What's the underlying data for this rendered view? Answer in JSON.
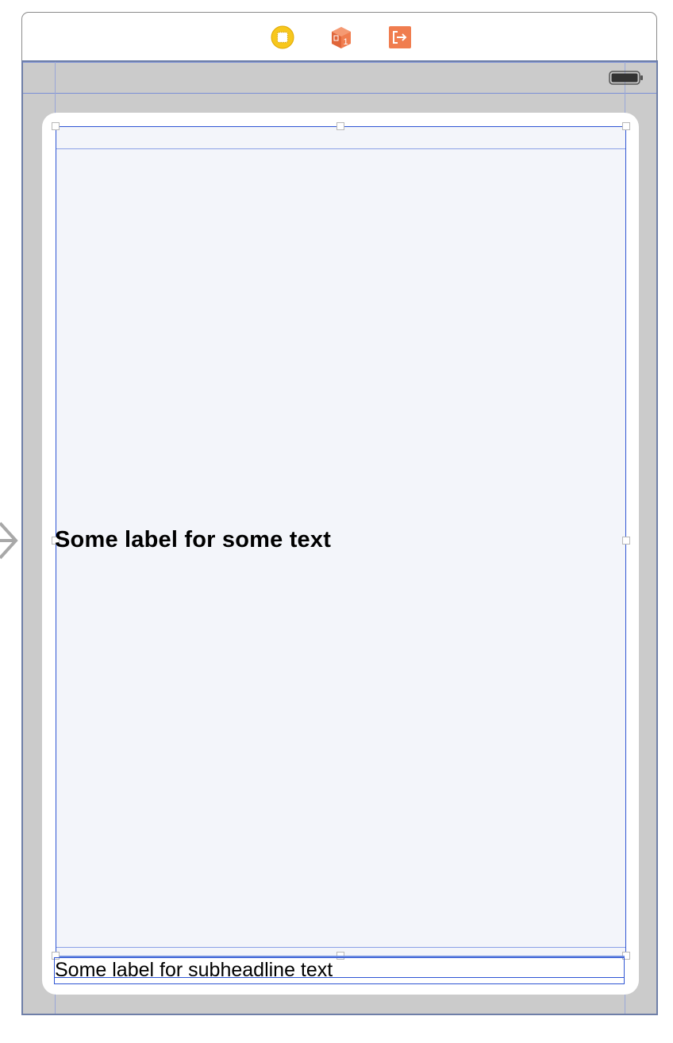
{
  "scene": {
    "dock": {
      "icons": [
        {
          "name": "view-controller-icon",
          "color": "#f5c518"
        },
        {
          "name": "first-responder-icon",
          "color": "#f07d4f"
        },
        {
          "name": "exit-icon",
          "color": "#f07d4f"
        }
      ],
      "first_responder_badge": "1"
    },
    "status_bar": {
      "battery_icon": "battery-icon"
    },
    "stack_view": {
      "headline_label": "Some label for some text",
      "subheadline_label": "Some label for subheadline text"
    },
    "colors": {
      "selection_blue": "#2f55d4",
      "device_gray": "#cbcbcb",
      "canvas_fill": "#f3f5fa"
    }
  }
}
